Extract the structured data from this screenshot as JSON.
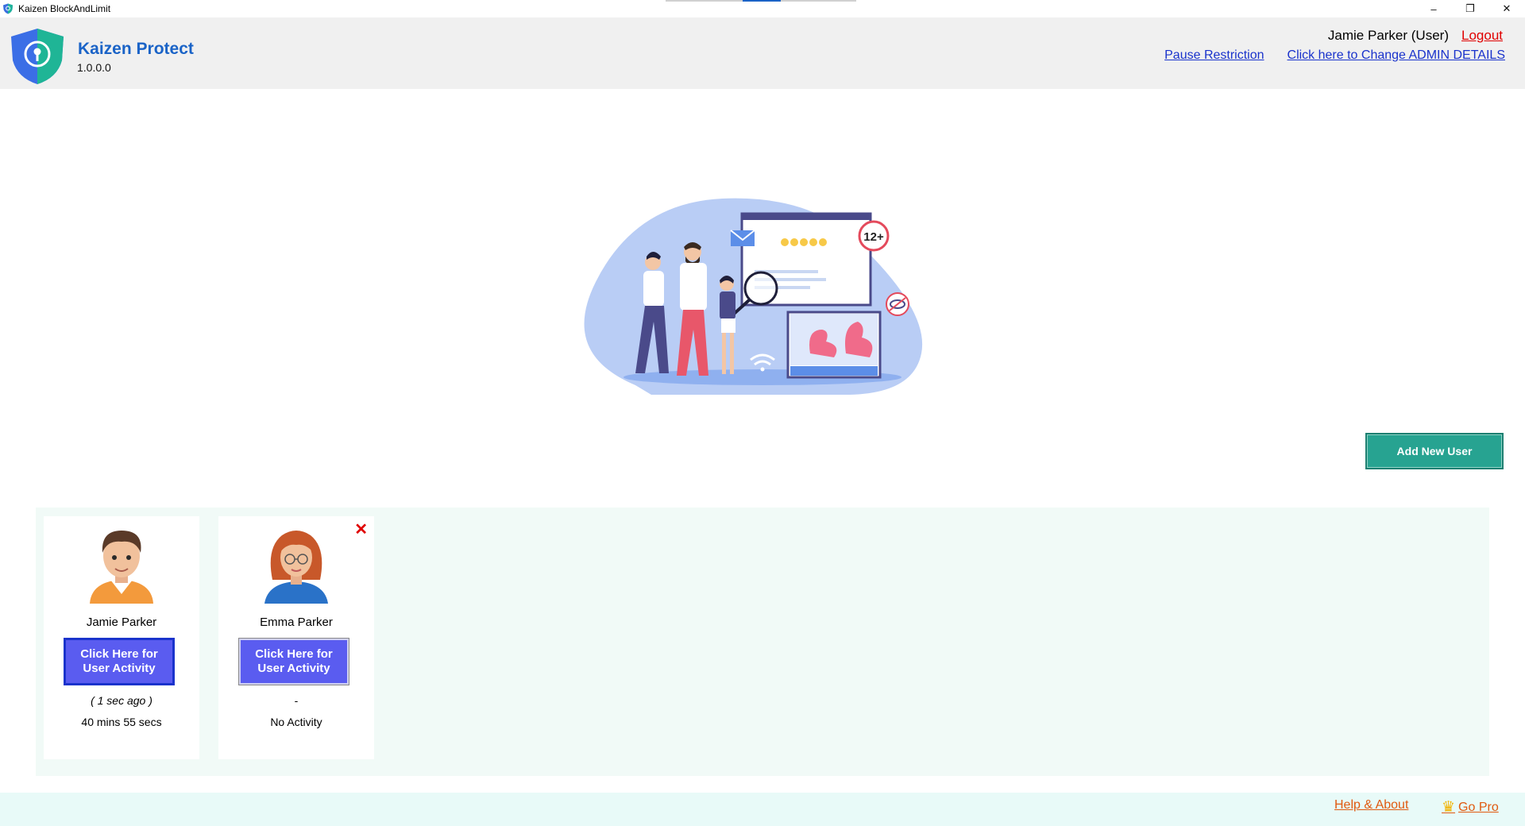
{
  "window": {
    "title": "Kaizen BlockAndLimit",
    "controls": {
      "minimize": "–",
      "restore": "❐",
      "close": "✕"
    }
  },
  "header": {
    "brand": "Kaizen Protect",
    "version": "1.0.0.0",
    "username": "Jamie Parker (User)",
    "logout": "Logout",
    "pause_link": "Pause Restriction",
    "admin_link": "Click here to Change ADMIN DETAILS"
  },
  "illustration": {
    "badge": "12+"
  },
  "actions": {
    "add_user": "Add New User"
  },
  "users": [
    {
      "name": "Jamie Parker",
      "button": "Click Here for User Activity",
      "ago": "( 1 sec ago )",
      "time": "40 mins 55 secs",
      "deletable": false
    },
    {
      "name": "Emma Parker",
      "button": "Click Here for User Activity",
      "ago": "-",
      "time": "No Activity",
      "deletable": true,
      "delete_icon": "✕"
    }
  ],
  "footer": {
    "help": "Help & About",
    "gopro": "Go Pro",
    "crown_icon": "♛"
  },
  "colors": {
    "brand": "#1a63c7",
    "logout": "#e00000",
    "link": "#1a33cc",
    "add_button": "#27a391",
    "activity_button": "#5a5cf0",
    "footer_link": "#e05a10"
  }
}
